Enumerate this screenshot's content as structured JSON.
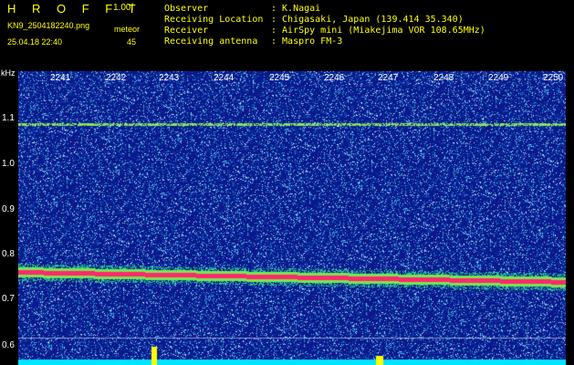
{
  "header": {
    "logo": "H R O F F T",
    "version": "1.00f",
    "filename": "KN9_2504182240.png",
    "datetime": "25.04.18 22:40",
    "meteor_label": "meteor",
    "meteor_count": "45"
  },
  "info": [
    {
      "label": "Observer",
      "value": ": K.Nagai"
    },
    {
      "label": "Receiving Location",
      "value": ": Chigasaki, Japan (139.414 35.340)"
    },
    {
      "label": "Receiver",
      "value": ": AirSpy mini (Miakejima VOR 108.65MHz)"
    },
    {
      "label": "Receiving antenna",
      "value": ": Maspro FM-3"
    }
  ],
  "axes": {
    "y_unit": "kHz",
    "y_ticks": [
      "1.1",
      "1.0",
      "0.9",
      "0.8",
      "0.7",
      "0.6"
    ],
    "x_ticks": [
      "2241",
      "2242",
      "2243",
      "2244",
      "2245",
      "2246",
      "2247",
      "2248",
      "2249",
      "2250"
    ]
  },
  "colors": {
    "text": "#ffff00",
    "background": "#000000",
    "waterfall_bg": "#0a1a8a",
    "carrier": "#ff3366"
  }
}
